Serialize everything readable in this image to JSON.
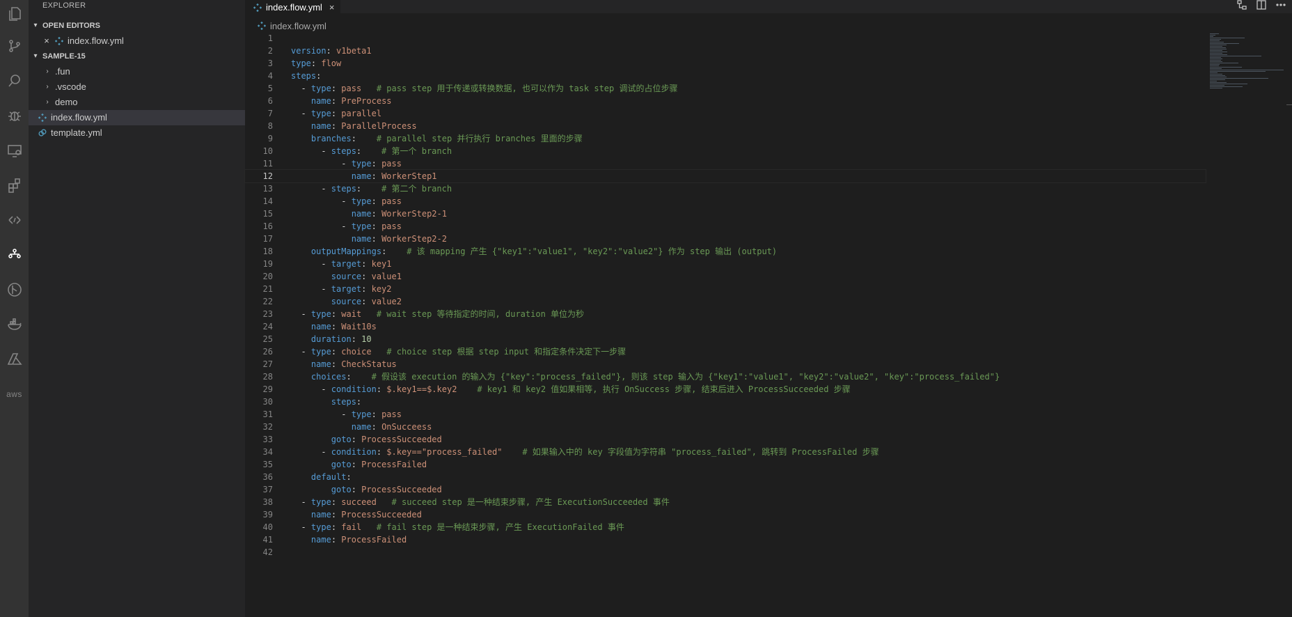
{
  "sidebar": {
    "title": "EXPLORER",
    "open_editors": {
      "label": "OPEN EDITORS",
      "files": [
        "index.flow.yml"
      ]
    },
    "project": {
      "label": "SAMPLE-15",
      "items": [
        ".fun",
        ".vscode",
        "demo",
        "index.flow.yml",
        "template.yml"
      ]
    }
  },
  "editor": {
    "tab_label": "index.flow.yml",
    "breadcrumb": "index.flow.yml",
    "current_line": 12,
    "lines": [
      {
        "num": "1",
        "tokens": []
      },
      {
        "num": "2",
        "tokens": [
          {
            "t": "k",
            "v": "version"
          },
          {
            "t": "p",
            "v": ": "
          },
          {
            "t": "s",
            "v": "v1beta1"
          }
        ]
      },
      {
        "num": "3",
        "tokens": [
          {
            "t": "k",
            "v": "type"
          },
          {
            "t": "p",
            "v": ": "
          },
          {
            "t": "s",
            "v": "flow"
          }
        ]
      },
      {
        "num": "4",
        "tokens": [
          {
            "t": "k",
            "v": "steps"
          },
          {
            "t": "p",
            "v": ":"
          }
        ]
      },
      {
        "num": "5",
        "tokens": [
          {
            "t": "p",
            "v": "  - "
          },
          {
            "t": "k",
            "v": "type"
          },
          {
            "t": "p",
            "v": ": "
          },
          {
            "t": "s",
            "v": "pass"
          },
          {
            "t": "p",
            "v": "   "
          },
          {
            "t": "c",
            "v": "# pass step 用于传递或转换数据, 也可以作为 task step 调试的占位步骤"
          }
        ]
      },
      {
        "num": "6",
        "tokens": [
          {
            "t": "p",
            "v": "    "
          },
          {
            "t": "k",
            "v": "name"
          },
          {
            "t": "p",
            "v": ": "
          },
          {
            "t": "s",
            "v": "PreProcess"
          }
        ]
      },
      {
        "num": "7",
        "tokens": [
          {
            "t": "p",
            "v": "  - "
          },
          {
            "t": "k",
            "v": "type"
          },
          {
            "t": "p",
            "v": ": "
          },
          {
            "t": "s",
            "v": "parallel"
          }
        ]
      },
      {
        "num": "8",
        "tokens": [
          {
            "t": "p",
            "v": "    "
          },
          {
            "t": "k",
            "v": "name"
          },
          {
            "t": "p",
            "v": ": "
          },
          {
            "t": "s",
            "v": "ParallelProcess"
          }
        ]
      },
      {
        "num": "9",
        "tokens": [
          {
            "t": "p",
            "v": "    "
          },
          {
            "t": "k",
            "v": "branches"
          },
          {
            "t": "p",
            "v": ":    "
          },
          {
            "t": "c",
            "v": "# parallel step 并行执行 branches 里面的步骤"
          }
        ]
      },
      {
        "num": "10",
        "tokens": [
          {
            "t": "p",
            "v": "      - "
          },
          {
            "t": "k",
            "v": "steps"
          },
          {
            "t": "p",
            "v": ":    "
          },
          {
            "t": "c",
            "v": "# 第一个 branch"
          }
        ]
      },
      {
        "num": "11",
        "tokens": [
          {
            "t": "p",
            "v": "          - "
          },
          {
            "t": "k",
            "v": "type"
          },
          {
            "t": "p",
            "v": ": "
          },
          {
            "t": "s",
            "v": "pass"
          }
        ]
      },
      {
        "num": "12",
        "tokens": [
          {
            "t": "p",
            "v": "            "
          },
          {
            "t": "k",
            "v": "name"
          },
          {
            "t": "p",
            "v": ": "
          },
          {
            "t": "s",
            "v": "WorkerStep1"
          }
        ]
      },
      {
        "num": "13",
        "tokens": [
          {
            "t": "p",
            "v": "      - "
          },
          {
            "t": "k",
            "v": "steps"
          },
          {
            "t": "p",
            "v": ":    "
          },
          {
            "t": "c",
            "v": "# 第二个 branch"
          }
        ]
      },
      {
        "num": "14",
        "tokens": [
          {
            "t": "p",
            "v": "          - "
          },
          {
            "t": "k",
            "v": "type"
          },
          {
            "t": "p",
            "v": ": "
          },
          {
            "t": "s",
            "v": "pass"
          }
        ]
      },
      {
        "num": "15",
        "tokens": [
          {
            "t": "p",
            "v": "            "
          },
          {
            "t": "k",
            "v": "name"
          },
          {
            "t": "p",
            "v": ": "
          },
          {
            "t": "s",
            "v": "WorkerStep2-1"
          }
        ]
      },
      {
        "num": "16",
        "tokens": [
          {
            "t": "p",
            "v": "          - "
          },
          {
            "t": "k",
            "v": "type"
          },
          {
            "t": "p",
            "v": ": "
          },
          {
            "t": "s",
            "v": "pass"
          }
        ]
      },
      {
        "num": "17",
        "tokens": [
          {
            "t": "p",
            "v": "            "
          },
          {
            "t": "k",
            "v": "name"
          },
          {
            "t": "p",
            "v": ": "
          },
          {
            "t": "s",
            "v": "WorkerStep2-2"
          }
        ]
      },
      {
        "num": "18",
        "tokens": [
          {
            "t": "p",
            "v": "    "
          },
          {
            "t": "k",
            "v": "outputMappings"
          },
          {
            "t": "p",
            "v": ":    "
          },
          {
            "t": "c",
            "v": "# 该 mapping 产生 {\"key1\":\"value1\", \"key2\":\"value2\"} 作为 step 输出 (output)"
          }
        ]
      },
      {
        "num": "19",
        "tokens": [
          {
            "t": "p",
            "v": "      - "
          },
          {
            "t": "k",
            "v": "target"
          },
          {
            "t": "p",
            "v": ": "
          },
          {
            "t": "s",
            "v": "key1"
          }
        ]
      },
      {
        "num": "20",
        "tokens": [
          {
            "t": "p",
            "v": "        "
          },
          {
            "t": "k",
            "v": "source"
          },
          {
            "t": "p",
            "v": ": "
          },
          {
            "t": "s",
            "v": "value1"
          }
        ]
      },
      {
        "num": "21",
        "tokens": [
          {
            "t": "p",
            "v": "      - "
          },
          {
            "t": "k",
            "v": "target"
          },
          {
            "t": "p",
            "v": ": "
          },
          {
            "t": "s",
            "v": "key2"
          }
        ]
      },
      {
        "num": "22",
        "tokens": [
          {
            "t": "p",
            "v": "        "
          },
          {
            "t": "k",
            "v": "source"
          },
          {
            "t": "p",
            "v": ": "
          },
          {
            "t": "s",
            "v": "value2"
          }
        ]
      },
      {
        "num": "23",
        "tokens": [
          {
            "t": "p",
            "v": "  - "
          },
          {
            "t": "k",
            "v": "type"
          },
          {
            "t": "p",
            "v": ": "
          },
          {
            "t": "s",
            "v": "wait"
          },
          {
            "t": "p",
            "v": "   "
          },
          {
            "t": "c",
            "v": "# wait step 等待指定的时间, duration 单位为秒"
          }
        ]
      },
      {
        "num": "24",
        "tokens": [
          {
            "t": "p",
            "v": "    "
          },
          {
            "t": "k",
            "v": "name"
          },
          {
            "t": "p",
            "v": ": "
          },
          {
            "t": "s",
            "v": "Wait10s"
          }
        ]
      },
      {
        "num": "25",
        "tokens": [
          {
            "t": "p",
            "v": "    "
          },
          {
            "t": "k",
            "v": "duration"
          },
          {
            "t": "p",
            "v": ": "
          },
          {
            "t": "n",
            "v": "10"
          }
        ]
      },
      {
        "num": "26",
        "tokens": [
          {
            "t": "p",
            "v": "  - "
          },
          {
            "t": "k",
            "v": "type"
          },
          {
            "t": "p",
            "v": ": "
          },
          {
            "t": "s",
            "v": "choice"
          },
          {
            "t": "p",
            "v": "   "
          },
          {
            "t": "c",
            "v": "# choice step 根据 step input 和指定条件决定下一步骤"
          }
        ]
      },
      {
        "num": "27",
        "tokens": [
          {
            "t": "p",
            "v": "    "
          },
          {
            "t": "k",
            "v": "name"
          },
          {
            "t": "p",
            "v": ": "
          },
          {
            "t": "s",
            "v": "CheckStatus"
          }
        ]
      },
      {
        "num": "28",
        "tokens": [
          {
            "t": "p",
            "v": "    "
          },
          {
            "t": "k",
            "v": "choices"
          },
          {
            "t": "p",
            "v": ":    "
          },
          {
            "t": "c",
            "v": "# 假设该 execution 的输入为 {\"key\":\"process_failed\"}, 则该 step 输入为 {\"key1\":\"value1\", \"key2\":\"value2\", \"key\":\"process_failed\"}"
          }
        ]
      },
      {
        "num": "29",
        "tokens": [
          {
            "t": "p",
            "v": "      - "
          },
          {
            "t": "k",
            "v": "condition"
          },
          {
            "t": "p",
            "v": ": "
          },
          {
            "t": "s",
            "v": "$.key1==$.key2"
          },
          {
            "t": "p",
            "v": "    "
          },
          {
            "t": "c",
            "v": "# key1 和 key2 值如果相等, 执行 OnSuccess 步骤, 结束后进入 ProcessSucceeded 步骤"
          }
        ]
      },
      {
        "num": "30",
        "tokens": [
          {
            "t": "p",
            "v": "        "
          },
          {
            "t": "k",
            "v": "steps"
          },
          {
            "t": "p",
            "v": ":"
          }
        ]
      },
      {
        "num": "31",
        "tokens": [
          {
            "t": "p",
            "v": "          - "
          },
          {
            "t": "k",
            "v": "type"
          },
          {
            "t": "p",
            "v": ": "
          },
          {
            "t": "s",
            "v": "pass"
          }
        ]
      },
      {
        "num": "32",
        "tokens": [
          {
            "t": "p",
            "v": "            "
          },
          {
            "t": "k",
            "v": "name"
          },
          {
            "t": "p",
            "v": ": "
          },
          {
            "t": "s",
            "v": "OnSucceess"
          }
        ]
      },
      {
        "num": "33",
        "tokens": [
          {
            "t": "p",
            "v": "        "
          },
          {
            "t": "k",
            "v": "goto"
          },
          {
            "t": "p",
            "v": ": "
          },
          {
            "t": "s",
            "v": "ProcessSucceeded"
          }
        ]
      },
      {
        "num": "34",
        "tokens": [
          {
            "t": "p",
            "v": "      - "
          },
          {
            "t": "k",
            "v": "condition"
          },
          {
            "t": "p",
            "v": ": "
          },
          {
            "t": "s",
            "v": "$.key==\"process_failed\""
          },
          {
            "t": "p",
            "v": "    "
          },
          {
            "t": "c",
            "v": "# 如果输入中的 key 字段值为字符串 \"process_failed\", 跳转到 ProcessFailed 步骤"
          }
        ]
      },
      {
        "num": "35",
        "tokens": [
          {
            "t": "p",
            "v": "        "
          },
          {
            "t": "k",
            "v": "goto"
          },
          {
            "t": "p",
            "v": ": "
          },
          {
            "t": "s",
            "v": "ProcessFailed"
          }
        ]
      },
      {
        "num": "36",
        "tokens": [
          {
            "t": "p",
            "v": "    "
          },
          {
            "t": "k",
            "v": "default"
          },
          {
            "t": "p",
            "v": ":"
          }
        ]
      },
      {
        "num": "37",
        "tokens": [
          {
            "t": "p",
            "v": "        "
          },
          {
            "t": "k",
            "v": "goto"
          },
          {
            "t": "p",
            "v": ": "
          },
          {
            "t": "s",
            "v": "ProcessSucceeded"
          }
        ]
      },
      {
        "num": "38",
        "tokens": [
          {
            "t": "p",
            "v": "  - "
          },
          {
            "t": "k",
            "v": "type"
          },
          {
            "t": "p",
            "v": ": "
          },
          {
            "t": "s",
            "v": "succeed"
          },
          {
            "t": "p",
            "v": "   "
          },
          {
            "t": "c",
            "v": "# succeed step 是一种结束步骤, 产生 ExecutionSucceeded 事件"
          }
        ]
      },
      {
        "num": "39",
        "tokens": [
          {
            "t": "p",
            "v": "    "
          },
          {
            "t": "k",
            "v": "name"
          },
          {
            "t": "p",
            "v": ": "
          },
          {
            "t": "s",
            "v": "ProcessSucceeded"
          }
        ]
      },
      {
        "num": "40",
        "tokens": [
          {
            "t": "p",
            "v": "  - "
          },
          {
            "t": "k",
            "v": "type"
          },
          {
            "t": "p",
            "v": ": "
          },
          {
            "t": "s",
            "v": "fail"
          },
          {
            "t": "p",
            "v": "   "
          },
          {
            "t": "c",
            "v": "# fail step 是一种结束步骤, 产生 ExecutionFailed 事件"
          }
        ]
      },
      {
        "num": "41",
        "tokens": [
          {
            "t": "p",
            "v": "    "
          },
          {
            "t": "k",
            "v": "name"
          },
          {
            "t": "p",
            "v": ": "
          },
          {
            "t": "s",
            "v": "ProcessFailed"
          }
        ]
      },
      {
        "num": "42",
        "tokens": []
      }
    ]
  },
  "activity_icons": [
    "files-icon",
    "source-control-icon",
    "search-icon",
    "debug-icon",
    "remote-explorer-icon",
    "extensions-icon",
    "api-icon",
    "workflow-icon",
    "git-graph-icon",
    "docker-icon",
    "azure-icon",
    "aws-icon"
  ],
  "colors": {
    "keyword": "#569cd6",
    "string": "#ce9178",
    "number": "#b5cea8",
    "comment": "#6a9955",
    "background": "#1e1e1e",
    "sidebar": "#252526",
    "activity_bar": "#333333"
  }
}
